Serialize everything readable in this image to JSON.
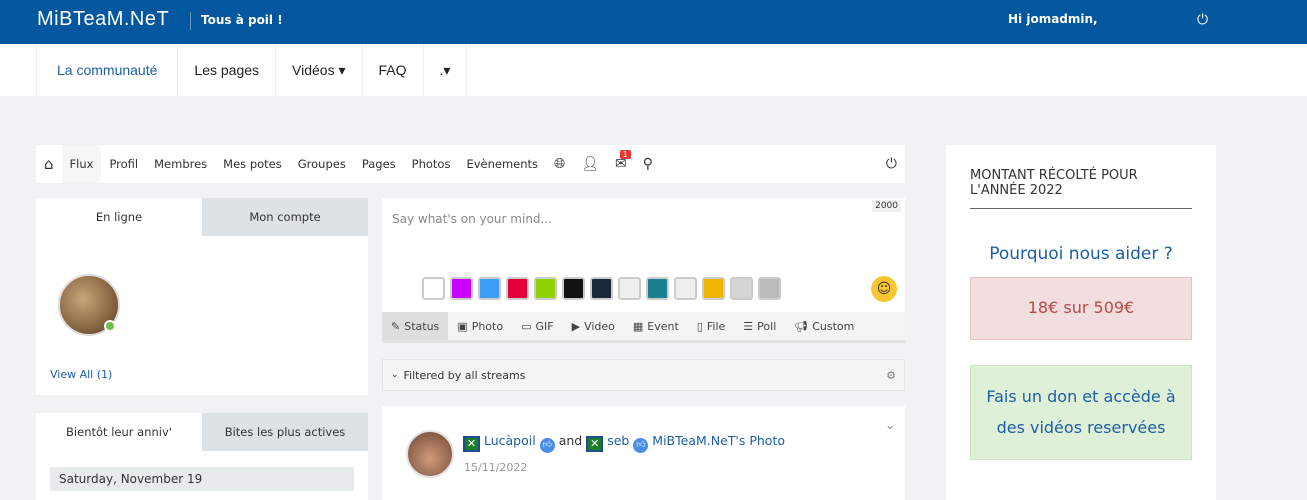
{
  "topbar": {
    "logo": "MiBTeaM.NeT",
    "tagline": "Tous à poil !",
    "greeting": "Hi jomadmin,"
  },
  "mainnav": [
    {
      "label": "La communauté"
    },
    {
      "label": "Les pages"
    },
    {
      "label": "Vidéos ▾"
    },
    {
      "label": "FAQ"
    },
    {
      "label": ".▾"
    }
  ],
  "social_nav": {
    "items": [
      "Flux",
      "Profil",
      "Membres",
      "Mes potes",
      "Groupes",
      "Pages",
      "Photos",
      "Evènements"
    ],
    "mail_badge": "1"
  },
  "online": {
    "tabs": [
      "En ligne",
      "Mon compte"
    ],
    "view_all": "View All (1)"
  },
  "birthdays": {
    "tabs": [
      "Bientôt leur anniv'",
      "Bites les plus actives"
    ],
    "date": "Saturday, November 19"
  },
  "composer": {
    "placeholder": "Say what's on your mind...",
    "counter": "2000",
    "swatches": [
      "#ffffff",
      "#c800ff",
      "#3d9df5",
      "#e4003a",
      "#8fd400",
      "#111111",
      "#1a2a3c",
      "#eeeeee",
      "#1a7f8f",
      "#eeeeee",
      "#f0b400",
      "#d5d5d5",
      "#bbbbbb"
    ],
    "tabs": [
      "Status",
      "Photo",
      "GIF",
      "Video",
      "Event",
      "File",
      "Poll",
      "Custom"
    ]
  },
  "filter": {
    "label": "Filtered by all streams"
  },
  "post": {
    "user1": "Lucàpoil",
    "and": "and",
    "user2": "seb",
    "target": "MiBTeaM.NeT's Photo",
    "date": "15/11/2022"
  },
  "sidebar": {
    "heading": "MONTANT RÉCOLTÉ POUR L'ANNÉE 2022",
    "why": "Pourquoi nous aider ?",
    "amount": "18€ sur 509€",
    "donate": "Fais un don et accède à des vidéos reservées"
  }
}
